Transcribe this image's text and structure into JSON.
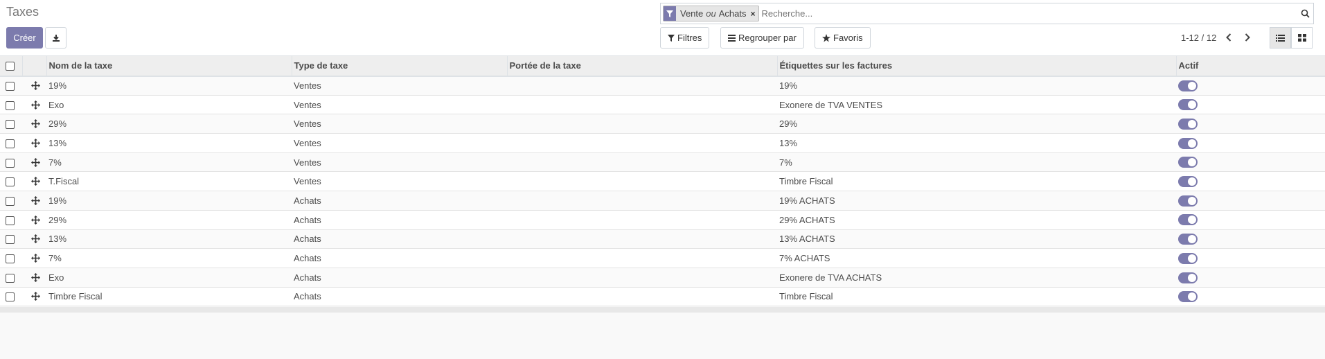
{
  "control_panel": {
    "title": "Taxes",
    "create_label": "Créer",
    "search": {
      "facet_value_1": "Vente",
      "facet_sep": "ou",
      "facet_value_2": "Achats",
      "facet_remove": "×",
      "placeholder": "Recherche..."
    },
    "filters_label": "Filtres",
    "groupby_label": "Regrouper par",
    "favorites_label": "Favoris",
    "pager": "1-12 / 12"
  },
  "table": {
    "columns": [
      "Nom de la taxe",
      "Type de taxe",
      "Portée de la taxe",
      "Étiquettes sur les factures",
      "Actif"
    ],
    "rows": [
      {
        "name": "19%",
        "type": "Ventes",
        "scope": "",
        "label": "19%",
        "active": true
      },
      {
        "name": "Exo",
        "type": "Ventes",
        "scope": "",
        "label": "Exonere de TVA VENTES",
        "active": true
      },
      {
        "name": "29%",
        "type": "Ventes",
        "scope": "",
        "label": "29%",
        "active": true
      },
      {
        "name": "13%",
        "type": "Ventes",
        "scope": "",
        "label": "13%",
        "active": true
      },
      {
        "name": "7%",
        "type": "Ventes",
        "scope": "",
        "label": "7%",
        "active": true
      },
      {
        "name": "T.Fiscal",
        "type": "Ventes",
        "scope": "",
        "label": "Timbre Fiscal",
        "active": true
      },
      {
        "name": "19%",
        "type": "Achats",
        "scope": "",
        "label": "19% ACHATS",
        "active": true
      },
      {
        "name": "29%",
        "type": "Achats",
        "scope": "",
        "label": "29% ACHATS",
        "active": true
      },
      {
        "name": "13%",
        "type": "Achats",
        "scope": "",
        "label": "13% ACHATS",
        "active": true
      },
      {
        "name": "7%",
        "type": "Achats",
        "scope": "",
        "label": "7% ACHATS",
        "active": true
      },
      {
        "name": "Exo",
        "type": "Achats",
        "scope": "",
        "label": "Exonere de TVA ACHATS",
        "active": true
      },
      {
        "name": "Timbre Fiscal",
        "type": "Achats",
        "scope": "",
        "label": "Timbre Fiscal",
        "active": true
      }
    ]
  },
  "colors": {
    "accent": "#7c7bad"
  }
}
